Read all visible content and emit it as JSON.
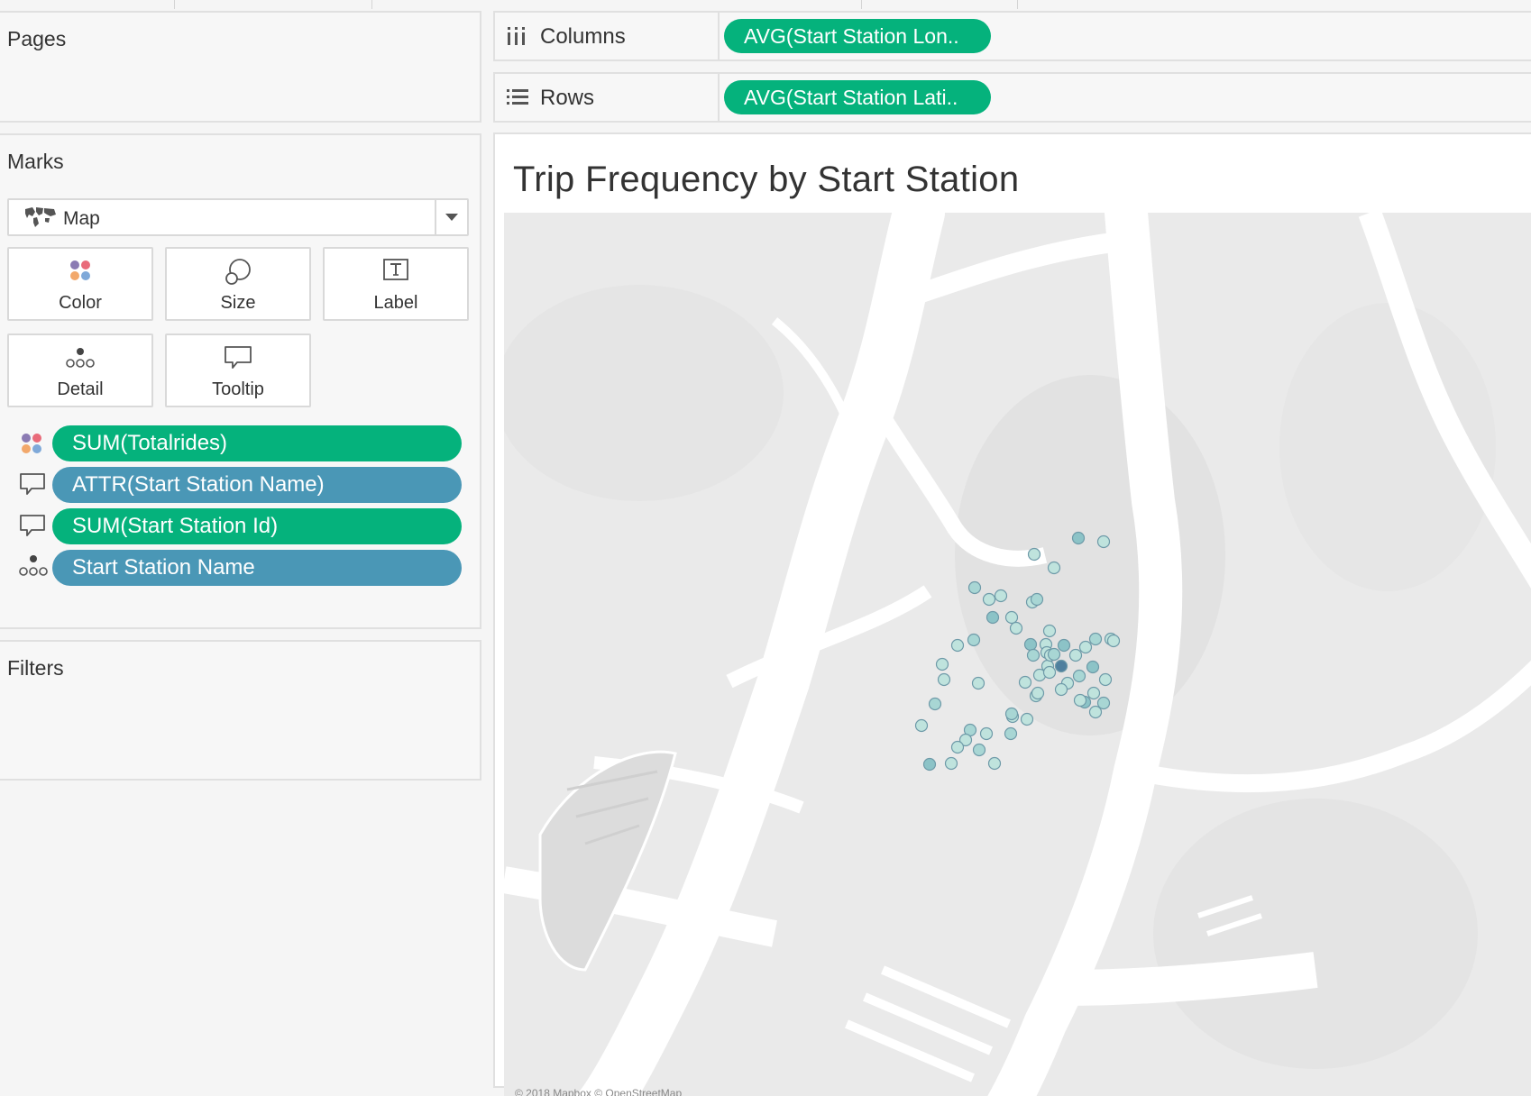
{
  "pages_pane": {
    "title": "Pages"
  },
  "marks_pane": {
    "title": "Marks",
    "mark_type": {
      "label": "Map",
      "icon": "world-map-icon"
    },
    "buttons": [
      {
        "label": "Color",
        "icon": "color-dots-icon"
      },
      {
        "label": "Size",
        "icon": "size-circles-icon"
      },
      {
        "label": "Label",
        "icon": "label-text-icon"
      },
      {
        "label": "Detail",
        "icon": "detail-dots-icon"
      },
      {
        "label": "Tooltip",
        "icon": "tooltip-bubble-icon"
      }
    ],
    "fields": [
      {
        "label": "SUM(Totalrides)",
        "encoding": "color",
        "type": "measure"
      },
      {
        "label": "ATTR(Start Station Name)",
        "encoding": "tooltip",
        "type": "dimension"
      },
      {
        "label": "SUM(Start Station Id)",
        "encoding": "tooltip",
        "type": "measure"
      },
      {
        "label": "Start Station Name",
        "encoding": "detail",
        "type": "dimension"
      }
    ]
  },
  "filters_pane": {
    "title": "Filters"
  },
  "shelves": {
    "columns": {
      "label": "Columns",
      "pill": "AVG(Start Station Lon.."
    },
    "rows": {
      "label": "Rows",
      "pill": "AVG(Start Station Lati.."
    }
  },
  "view": {
    "title": "Trip Frequency by Start Station",
    "attribution": "© 2018 Mapbox © OpenStreetMap"
  },
  "colors": {
    "measure_pill": "#05b27c",
    "dimension_pill": "#4a97b6",
    "map_land": "#eaeaea",
    "map_water": "#ffffff",
    "point_light": "#bfe3dd",
    "point_dark": "#4f7f9e"
  }
}
